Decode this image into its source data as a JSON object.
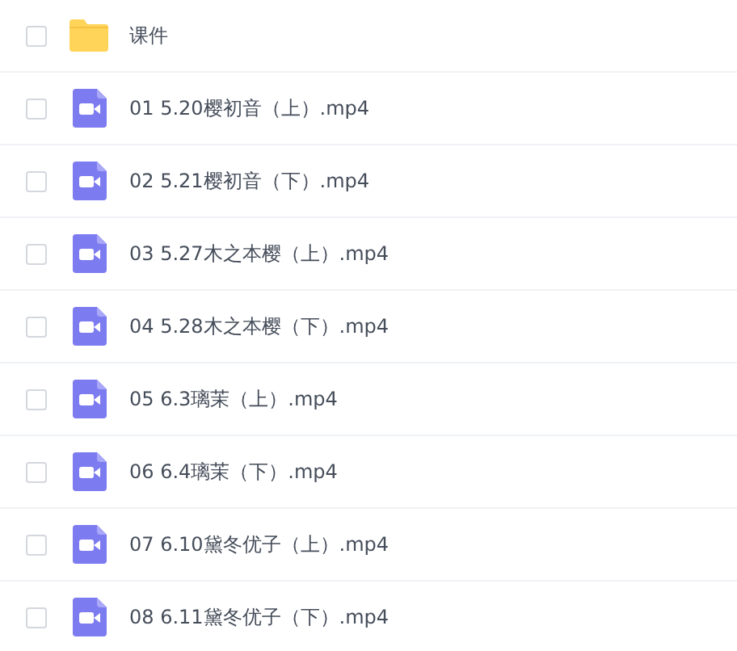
{
  "files": [
    {
      "kind": "folder",
      "name": "课件",
      "checked": false
    },
    {
      "kind": "video",
      "name": "01 5.20樱初音（上）.mp4",
      "checked": false
    },
    {
      "kind": "video",
      "name": "02 5.21樱初音（下）.mp4",
      "checked": false
    },
    {
      "kind": "video",
      "name": "03 5.27木之本樱（上）.mp4",
      "checked": false
    },
    {
      "kind": "video",
      "name": "04 5.28木之本樱（下）.mp4",
      "checked": false
    },
    {
      "kind": "video",
      "name": "05 6.3璃茉（上）.mp4",
      "checked": false
    },
    {
      "kind": "video",
      "name": "06 6.4璃茉（下）.mp4",
      "checked": false
    },
    {
      "kind": "video",
      "name": "07 6.10黛冬优子（上）.mp4",
      "checked": false
    },
    {
      "kind": "video",
      "name": "08 6.11黛冬优子（下）.mp4",
      "checked": false
    }
  ]
}
